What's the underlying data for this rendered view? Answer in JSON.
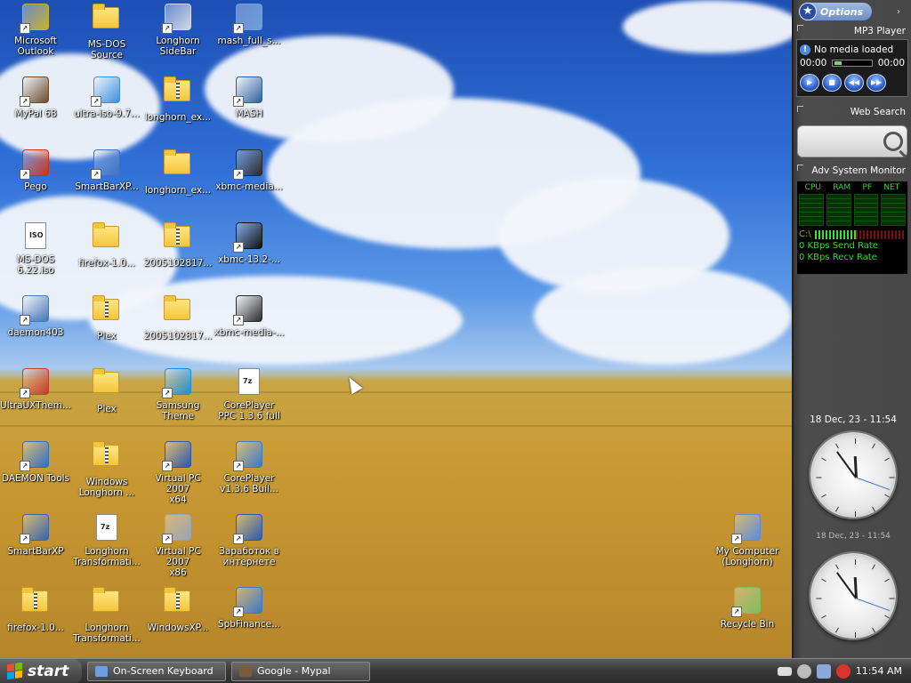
{
  "desktop": {
    "icons": [
      {
        "label": "Microsoft\nOutlook",
        "kind": "app",
        "color": "#c7b22b"
      },
      {
        "label": "MS-DOS\nSource",
        "kind": "folder"
      },
      {
        "label": "Longhorn\nSideBar",
        "kind": "app",
        "color": "#cfd8e6"
      },
      {
        "label": "mash_full_s...",
        "kind": "app",
        "color": "#6da0d8"
      },
      {
        "label": "MyPal 68",
        "kind": "app",
        "color": "#6b4b2a"
      },
      {
        "label": "ultra-iso-9.7...",
        "kind": "app",
        "color": "#3b8fdc"
      },
      {
        "label": "longhorn_ex...",
        "kind": "zip"
      },
      {
        "label": "MASH",
        "kind": "app",
        "color": "#2f5e9c"
      },
      {
        "label": "Pego",
        "kind": "app",
        "color": "#c8331e"
      },
      {
        "label": "SmartBarXP...",
        "kind": "app",
        "color": "#3e73c1"
      },
      {
        "label": "longhorn_ex...",
        "kind": "folder"
      },
      {
        "label": "xbmc-media...",
        "kind": "app",
        "color": "#2a2a2a"
      },
      {
        "label": "MS-DOS\n6.22.iso",
        "kind": "doc",
        "doc": "ISO"
      },
      {
        "label": "firefox-1.0...",
        "kind": "folder"
      },
      {
        "label": "2005102817...",
        "kind": "zip"
      },
      {
        "label": "xbmc-13.2-...",
        "kind": "app",
        "color": "#111111"
      },
      {
        "label": "daemon403",
        "kind": "app",
        "color": "#4a77b5"
      },
      {
        "label": "Plex",
        "kind": "zip"
      },
      {
        "label": "2005102817...",
        "kind": "folder"
      },
      {
        "label": "xbmc-media-...",
        "kind": "app",
        "color": "#2a2a2a"
      },
      {
        "label": "UltraUXThem...",
        "kind": "app",
        "color": "#c33d2b"
      },
      {
        "label": "Plex",
        "kind": "folder"
      },
      {
        "label": "Samsung\nTheme",
        "kind": "app",
        "color": "#1d8fd6"
      },
      {
        "label": "CorePlayer\nPPC 1.3.6 full",
        "kind": "doc",
        "doc": "7z"
      },
      {
        "label": "DAEMON Tools",
        "kind": "app",
        "color": "#2d6ec2"
      },
      {
        "label": "Windows\nLonghorn ...",
        "kind": "zip"
      },
      {
        "label": "Virtual PC 2007\nx64",
        "kind": "app",
        "color": "#2d56a8"
      },
      {
        "label": "CorePlayer\nv1.3.6 Buil...",
        "kind": "app",
        "color": "#3a79c8"
      },
      {
        "label": "SmartBarXP",
        "kind": "app",
        "color": "#3b66a6"
      },
      {
        "label": "Longhorn\nTransformati...",
        "kind": "doc",
        "doc": "7z"
      },
      {
        "label": "Virtual PC 2007\nx86",
        "kind": "app",
        "color": "#9aa3b5"
      },
      {
        "label": "Заработок в\nинтернете",
        "kind": "app",
        "color": "#2b5aa8"
      },
      {
        "label": "firefox-1.0...",
        "kind": "zip"
      },
      {
        "label": "Longhorn\nTransformati...",
        "kind": "folder"
      },
      {
        "label": "WindowsXP...",
        "kind": "zip"
      },
      {
        "label": "SpbFinance...",
        "kind": "app",
        "color": "#3a79c8"
      },
      {
        "label": "My Computer\n(Longhorn)",
        "kind": "app",
        "color": "#5b8ed8"
      },
      {
        "label": "Recycle Bin",
        "kind": "app",
        "color": "#7fbf5a"
      }
    ]
  },
  "sidebar": {
    "options_label": "Options",
    "mp3": {
      "title": "MP3 Player",
      "status": "No media loaded",
      "time_start": "00:00",
      "time_end": "00:00"
    },
    "web_search": {
      "title": "Web Search"
    },
    "sysmon": {
      "title": "Adv System Monitor",
      "headers": [
        "CPU",
        "RAM",
        "PF",
        "NET"
      ],
      "drive": "C:\\",
      "send_rate": "0 KBps Send Rate",
      "recv_rate": "0 KBps Recv Rate"
    },
    "clock1": {
      "label": "18 Dec, 23 - 11:54"
    },
    "clock2": {
      "label": "18 Dec, 23 - 11:54"
    }
  },
  "taskbar": {
    "start_label": "start",
    "tasks": [
      "On-Screen Keyboard",
      "Google - Mypal"
    ],
    "clock": "11:54 AM"
  },
  "colors": {
    "taskbar": "#3a3a3a",
    "sidebar": "#474747",
    "monitor_green": "#2fdc2f",
    "mp3_button": "#1c4fc2"
  }
}
